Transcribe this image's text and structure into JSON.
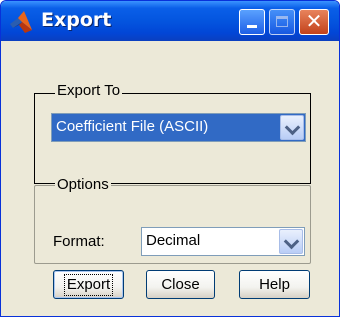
{
  "window": {
    "title": "Export",
    "controls": {
      "minimize": "minimize",
      "maximize": "maximize",
      "close": "close"
    }
  },
  "export_to": {
    "group_label": "Export To",
    "selected": "Coefficient File (ASCII)"
  },
  "options": {
    "group_label": "Options",
    "format_label": "Format:",
    "format_selected": "Decimal"
  },
  "buttons": {
    "export": "Export",
    "close": "Close",
    "help": "Help"
  },
  "icons": {
    "app": "matlab-logo-icon",
    "dropdown": "chevron-down-icon"
  }
}
